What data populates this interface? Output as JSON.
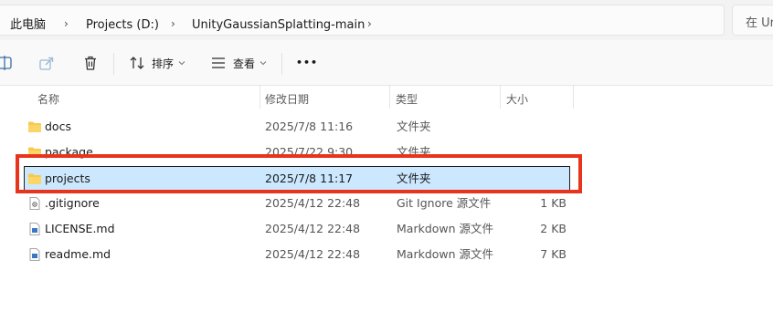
{
  "address_bar": {
    "crumbs": [
      "此电脑",
      "Projects (D:)",
      "UnityGaussianSplatting-main"
    ],
    "separator": "›"
  },
  "search": {
    "placeholder": "在 Un"
  },
  "command_bar": {
    "sort_label": "排序",
    "view_label": "查看",
    "more_label": "•••"
  },
  "columns": {
    "name": "名称",
    "date": "修改日期",
    "type": "类型",
    "size": "大小"
  },
  "files": [
    {
      "name": "docs",
      "date": "2025/7/8 11:16",
      "type": "文件夹",
      "size": "",
      "icon": "folder-icon",
      "selected": false
    },
    {
      "name": "package",
      "date": "2025/7/22 9:30",
      "type": "文件夹",
      "size": "",
      "icon": "folder-icon",
      "selected": false
    },
    {
      "name": "projects",
      "date": "2025/7/8 11:17",
      "type": "文件夹",
      "size": "",
      "icon": "folder-icon",
      "selected": true
    },
    {
      "name": ".gitignore",
      "date": "2025/4/12 22:48",
      "type": "Git Ignore 源文件",
      "size": "1 KB",
      "icon": "gear-file-icon",
      "selected": false
    },
    {
      "name": "LICENSE.md",
      "date": "2025/4/12 22:48",
      "type": "Markdown 源文件",
      "size": "2 KB",
      "icon": "markdown-file-icon",
      "selected": false
    },
    {
      "name": "readme.md",
      "date": "2025/4/12 22:48",
      "type": "Markdown 源文件",
      "size": "7 KB",
      "icon": "markdown-file-icon",
      "selected": false
    }
  ],
  "colors": {
    "selection_fill": "#cce8ff",
    "annotation_red": "#e8341c",
    "folder_yellow": "#f8c94a"
  }
}
